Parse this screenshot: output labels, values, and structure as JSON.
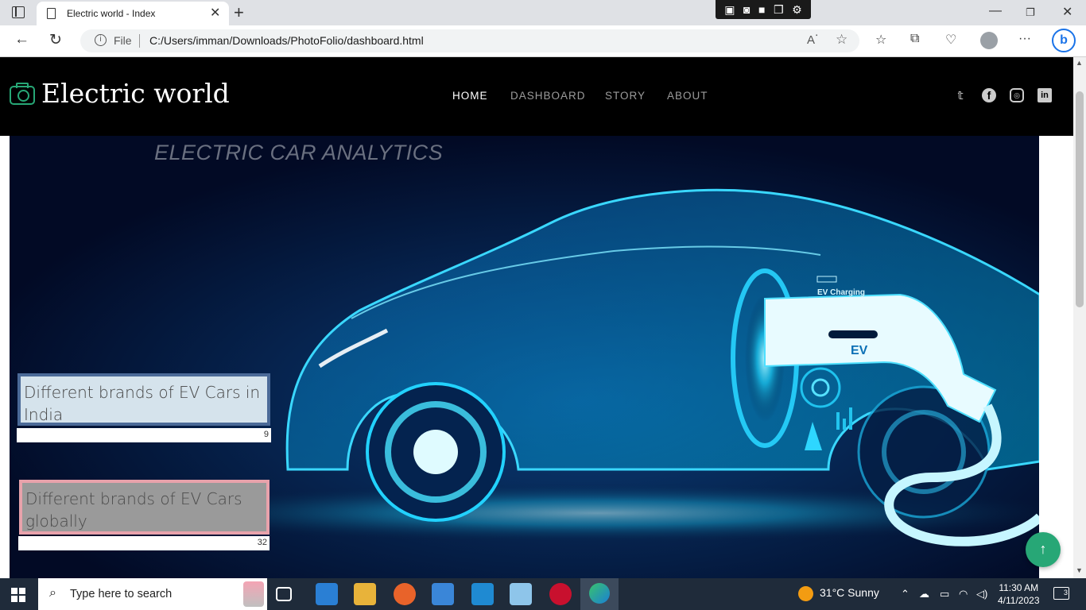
{
  "browser": {
    "tab_title": "Electric world - Index",
    "tab_close": "✕",
    "new_tab": "+",
    "address_scheme": "File",
    "address_url": "C:/Users/imman/Downloads/PhotoFolio/dashboard.html",
    "window_controls": {
      "minimize": "—",
      "maximize": "❐",
      "close": "✕"
    }
  },
  "site": {
    "logo_text": "Electric world",
    "nav": [
      {
        "label": "HOME",
        "active": true
      },
      {
        "label": "DASHBOARD",
        "active": false
      },
      {
        "label": "STORY",
        "active": false
      },
      {
        "label": "ABOUT",
        "active": false
      }
    ],
    "social": [
      "twitter-icon",
      "facebook-icon",
      "instagram-icon",
      "linkedin-icon"
    ]
  },
  "dashboard": {
    "title": "ELECTRIC CAR ANALYTICS",
    "image_labels": {
      "charging": "EV Charging",
      "plug": "EV"
    },
    "cards": [
      {
        "label": "Different brands of EV Cars in India",
        "count": "9"
      },
      {
        "label": "Different brands of EV Cars globally",
        "count": "32"
      }
    ],
    "colors": {
      "india_bg": "#d5e3ec",
      "india_border": "#4b6a98",
      "global_bg": "#9a9a9a",
      "global_border": "#e8a2ab",
      "accent": "#27a776"
    }
  },
  "taskbar": {
    "search_placeholder": "Type here to search",
    "weather": "31°C  Sunny",
    "time": "11:30 AM",
    "date": "4/11/2023",
    "notifications": "3"
  }
}
